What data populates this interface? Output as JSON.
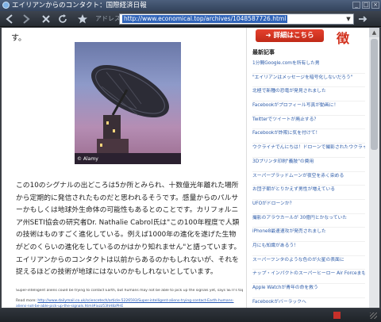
{
  "window": {
    "title": "エイリアンからのコンタクト：国際経済日報",
    "controls": [
      "_",
      "□",
      "×"
    ]
  },
  "toolbar": {
    "back_icon": "back-arrow-icon",
    "forward_icon": "forward-arrow-icon",
    "stop_icon": "stop-icon",
    "reload_icon": "reload-icon",
    "favorite_icon": "star-icon",
    "address_label": "アドレス(D)",
    "url": "http://www.economical.top/archives/1048587726.html"
  },
  "article": {
    "leading_fragment": "す。",
    "image_credit": "© Alamy",
    "paragraph": "この10のシグナルの出どころは5か所とみられ、十数億光年離れた場所から定期的に発信されたものだと思われるそうです。感量からのパルサーかもしくは地球外生命体の可能性もあるとのことです。カリフォルニア州SETI協会の研究者Dr. Nathalie Cabrol氏は\"この100年程度で人類の技術はものすごく進化している。例えば1000年の進化を遂げた生物がどのくらいの進化をしているのかはかり知れません\"と語っています。エイリアンからのコンタクトは以前からあるのかもしれないが、それを捉えるほどの技術が地球にはないのかもしれないとしています。",
    "english_note": "Super-intelligent aliens could be trying to contact Earth, but humans may not be able to pick up the signals yet, says SETI's top scientist",
    "read_more_label": "Read more:",
    "read_more_url": "http://www.dailymail.co.uk/sciencetech/article-5226593/Super-intelligent-aliens-trying-contact-Earth-humans-aliens-not-be-able-pick-up-the-signals.html#ixzz53hH8zPHE"
  },
  "sidebar": {
    "detail_button": "詳細はこちら",
    "badge_char": "徴",
    "heading": "最新記事",
    "items": [
      "1分間Google.comを所有した男",
      "\"エイリアンはメッセージを暗号化しないだろう\"",
      "北極で新種の恐竜が発見されました",
      "Facebookがプロフィール写真が動画に！",
      "Twitterでツイートが廃止する？",
      "Facebookが詐欺に気を付けて！",
      "ウクライナでんにちは！ドローンで撮影されたウクライナが話題",
      "3Dプリンタ印刷\"義肢\"の費用",
      "スーパーブラッドムーンが夜空を赤く染める",
      "お団子朝がとりかえず男性が増えている",
      "UFOがドローンか？",
      "撮影のアラウカールが 30億円とかなっていた",
      "iPhone8最速速攻が発売されました",
      "月にも知識があるう！",
      "スーパーフンタのような色のが火星の表面に",
      "ナップ・インパクトのスーパーヒーロー Air Forceまもなく登場",
      "Apple Watchが青年の命を救う",
      "Facebookがバーラックへ"
    ]
  },
  "statusbar": {
    "resize_icon": "resize-grip-icon"
  }
}
